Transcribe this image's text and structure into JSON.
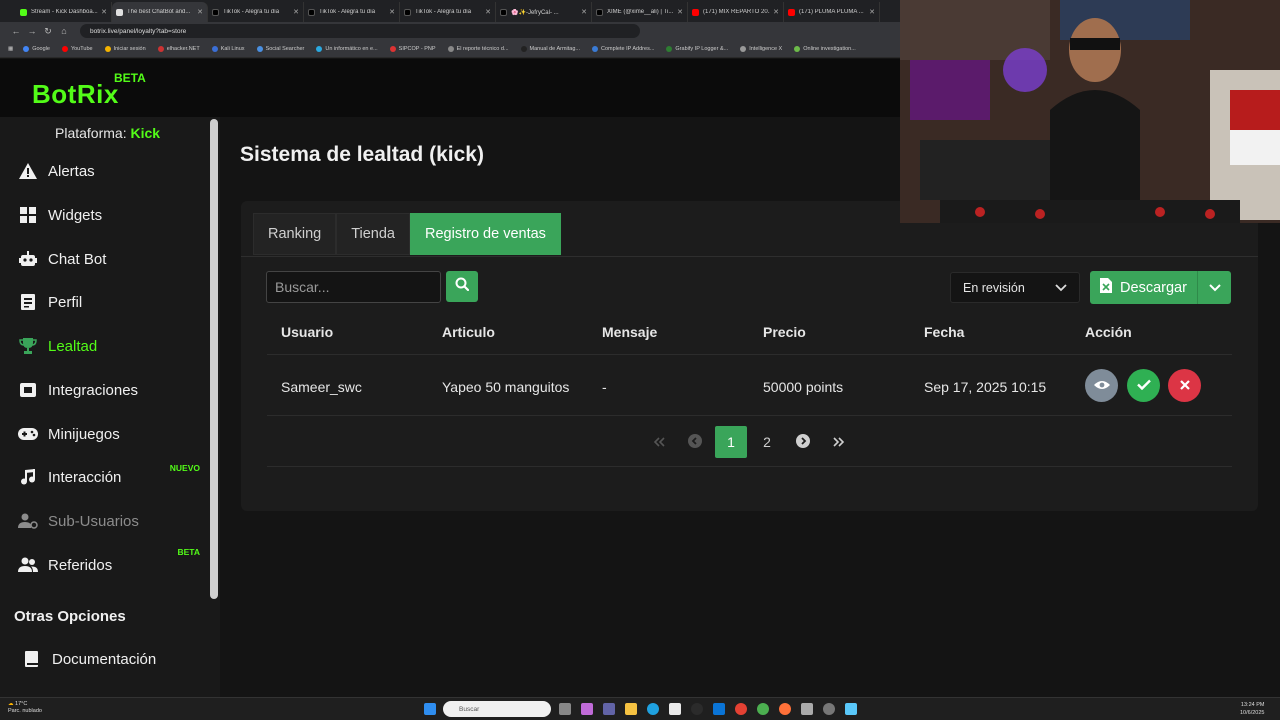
{
  "browser": {
    "tabs": [
      {
        "title": "Stream - Kick Dashboa...",
        "color": "#53fc18"
      },
      {
        "title": "The best ChatBot and...",
        "color": "#e0e0e0",
        "active": true
      },
      {
        "title": "TikTok - Alegra tu día",
        "color": "#111111"
      },
      {
        "title": "TikTok - Alegra tu día",
        "color": "#111111"
      },
      {
        "title": "TikTok - Alegra tu día",
        "color": "#111111"
      },
      {
        "title": "🌸✨-JefryCal- ...",
        "color": "#111111"
      },
      {
        "title": "XIME (@xime__ali) | Ti...",
        "color": "#111111"
      },
      {
        "title": "(171) MIX REPARTO 20...",
        "color": "#ff0000"
      },
      {
        "title": "(171) PLUMA PLUMA ...",
        "color": "#ff0000"
      }
    ],
    "url": "botrix.live/panel/loyalty?tab=store",
    "bookmarks": [
      "Google",
      "YouTube",
      "Iniciar sesión",
      "elhacker.NET",
      "Kali Linux",
      "Social Searcher",
      "Un informático en e...",
      "SIPCOP - PNP",
      "El reporte técnico d...",
      "Manual de Armitag...",
      "Complete IP Addres...",
      "Grabify IP Logger &...",
      "Intelligence X",
      "Online investigation..."
    ]
  },
  "brand": {
    "name": "BotRix",
    "badge": "BETA",
    "accent": "#53fc18",
    "green": "#3aa55a"
  },
  "sidebar": {
    "platform_label": "Plataforma:",
    "platform_value": "Kick",
    "items": [
      {
        "label": "Alertas",
        "icon": "warning-icon"
      },
      {
        "label": "Widgets",
        "icon": "grid-icon"
      },
      {
        "label": "Chat Bot",
        "icon": "robot-icon"
      },
      {
        "label": "Perfil",
        "icon": "id-card-icon"
      },
      {
        "label": "Lealtad",
        "icon": "trophy-icon",
        "active": true
      },
      {
        "label": "Integraciones",
        "icon": "plug-icon"
      },
      {
        "label": "Minijuegos",
        "icon": "gamepad-icon"
      },
      {
        "label": "Interacción",
        "icon": "music-icon",
        "badge": "NUEVO"
      },
      {
        "label": "Sub-Usuarios",
        "icon": "users-cog-icon",
        "muted": true
      },
      {
        "label": "Referidos",
        "icon": "users-icon",
        "badge": "BETA"
      }
    ],
    "other_title": "Otras Opciones",
    "other_items": [
      {
        "label": "Documentación",
        "icon": "book-icon"
      }
    ]
  },
  "page": {
    "title": "Sistema de lealtad (kick)"
  },
  "tabs": [
    "Ranking",
    "Tienda",
    "Registro de ventas"
  ],
  "toolbar": {
    "search_placeholder": "Buscar...",
    "status_value": "En revisión",
    "download_label": "Descargar"
  },
  "table": {
    "headers": [
      "Usuario",
      "Articulo",
      "Mensaje",
      "Precio",
      "Fecha",
      "Acción"
    ],
    "rows": [
      {
        "usuario": "Sameer_swc",
        "articulo": "Yapeo 50 manguitos",
        "mensaje": "-",
        "precio": "50000 points",
        "fecha": "Sep 17, 2025 10:15"
      }
    ]
  },
  "pagination": {
    "pages": [
      "1",
      "2"
    ],
    "current": "1"
  },
  "taskbar": {
    "weather_temp": "17°C",
    "weather_desc": "Parc. nublado",
    "search_placeholder": "Buscar",
    "time": "13:24 PM",
    "date": "10/6/2025"
  }
}
